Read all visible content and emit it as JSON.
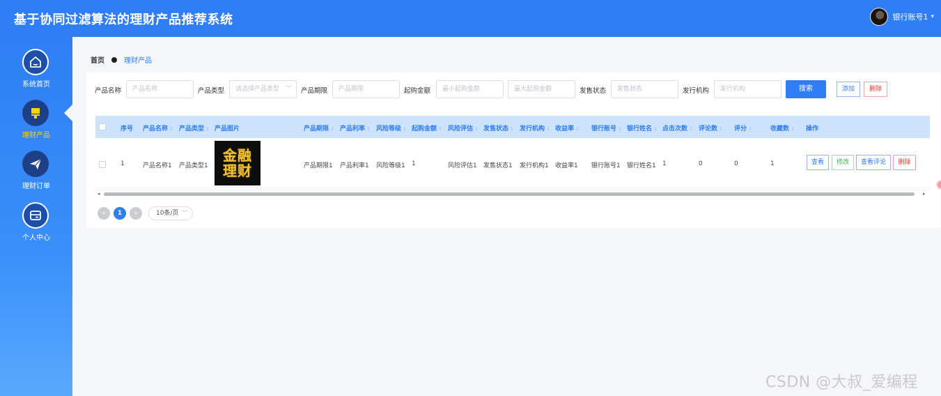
{
  "header": {
    "title": "基于协同过滤算法的理财产品推荐系统",
    "user_name": "银行账号1",
    "caret": "▾"
  },
  "sidebar": {
    "items": [
      {
        "label": "系统首页",
        "icon": "home-icon"
      },
      {
        "label": "理财产品",
        "icon": "flag-icon"
      },
      {
        "label": "理财订单",
        "icon": "send-icon"
      },
      {
        "label": "个人中心",
        "icon": "card-icon"
      }
    ]
  },
  "breadcrumb": {
    "home": "首页",
    "current": "理财产品"
  },
  "search": {
    "name_label": "产品名称",
    "name_placeholder": "产品名称",
    "type_label": "产品类型",
    "type_placeholder": "请选择产品类型",
    "term_label": "产品期限",
    "term_placeholder": "产品期限",
    "amount_label": "起购金额",
    "min_placeholder": "最小起购金额",
    "max_placeholder": "最大起购金额",
    "status_label": "发售状态",
    "status_placeholder": "发售状态",
    "org_label": "发行机构",
    "org_placeholder": "发行机构",
    "search_button": "搜索",
    "add_button": "添加",
    "delete_button": "删除"
  },
  "table": {
    "columns": [
      "序号",
      "产品名称",
      "产品类型",
      "产品图片",
      "产品期限",
      "产品利率",
      "风险等级",
      "起购金额",
      "风险评估",
      "发售状态",
      "发行机构",
      "收益率",
      "银行账号",
      "银行姓名",
      "点击次数",
      "评论数",
      "评分",
      "收藏数",
      "操作"
    ],
    "rows": [
      {
        "index": "1",
        "name": "产品名称1",
        "type": "产品类型1",
        "image_text_line1": "金融",
        "image_text_line2": "理财",
        "term": "产品期限1",
        "rate": "产品利率1",
        "risk_level": "风险等级1",
        "min_amount": "1",
        "risk_eval": "风险评估1",
        "status": "发售状态1",
        "org": "发行机构1",
        "yield": "收益率1",
        "bank_account": "银行账号1",
        "bank_name": "银行姓名1",
        "clicks": "1",
        "comments": "0",
        "score": "0",
        "favorites": "1",
        "actions": {
          "view": "查看",
          "edit": "修改",
          "view_comments": "查看评论",
          "delete": "删除"
        }
      }
    ],
    "scroll_left": "◂",
    "scroll_right": "▸"
  },
  "pagination": {
    "prev": "<",
    "current_page": "1",
    "next": ">",
    "page_size": "10条/页"
  },
  "watermark": "CSDN @大叔_爱编程",
  "colors": {
    "primary": "#2f7ef6",
    "header_bg": "#cde2fb",
    "danger": "#e33",
    "success": "#3bb54a"
  }
}
